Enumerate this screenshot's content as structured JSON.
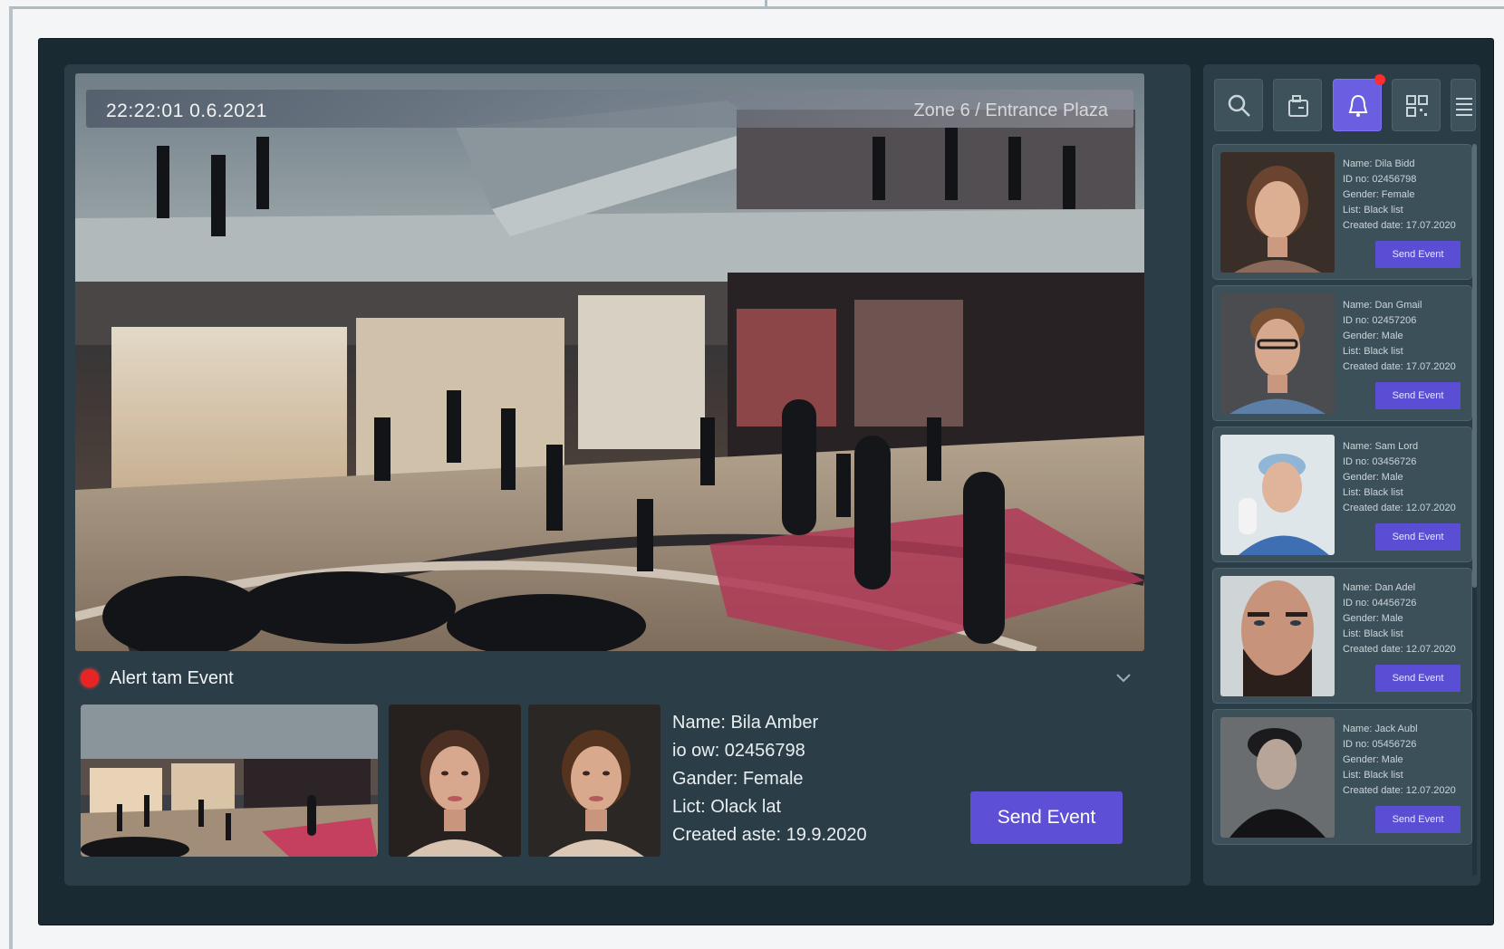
{
  "camera": {
    "timestamp": "22:22:01   0.6.2021",
    "location": "Zone 6 / Entrance Plaza"
  },
  "alert": {
    "title": "Alert tam Event"
  },
  "event": {
    "name": "Name: Bila Amber",
    "id": "io ow: 02456798",
    "gender": "Gander: Female",
    "list": "Lict: Olack lat",
    "created": "Created aste: 19.9.2020",
    "send_label": "Send Event"
  },
  "toolbar": {
    "icons": [
      "search-icon",
      "device-icon",
      "bell-icon",
      "qr-icon",
      "menu-icon"
    ],
    "active": "bell-icon",
    "accent": "#5d4fd6"
  },
  "people": [
    {
      "text": "Name: Dila Bidd\nID no: 02456798\nGender: Female\nList: Black list\nCreated date: 17.07.2020",
      "button": "Send Event"
    },
    {
      "text": "Name: Dan Gmail\nID no: 02457206\nGender: Male\nList: Black list\nCreated date: 17.07.2020",
      "button": "Send Event"
    },
    {
      "text": "Name: Sam Lord\nID no: 03456726\nGender: Male\nList: Black list\nCreated date: 12.07.2020",
      "button": "Send Event"
    },
    {
      "text": "Name: Dan Adel\nID no: 04456726\nGender: Male\nList: Black list\nCreated date: 12.07.2020",
      "button": "Send Event"
    },
    {
      "text": "Name: Jack Aubl\nID no: 05456726\nGender: Male\nList: Black list\nCreated date: 12.07.2020",
      "button": "Send Event"
    }
  ]
}
